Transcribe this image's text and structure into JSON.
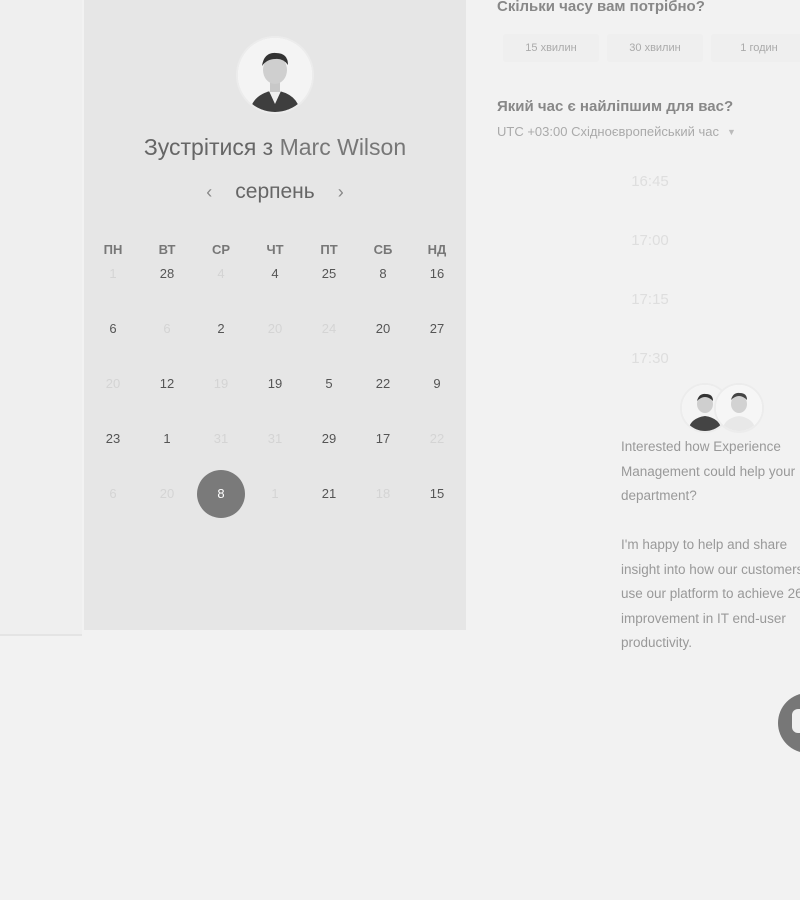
{
  "meeting": {
    "title_prefix": "Зустрітися з",
    "host_name": "Marc Wilson"
  },
  "calendar": {
    "month": "серпень",
    "weekdays": [
      "ПН",
      "ВТ",
      "СР",
      "ЧТ",
      "ПТ",
      "СБ",
      "НД"
    ],
    "weeks": [
      [
        {
          "d": "1",
          "dim": true
        },
        {
          "d": "28"
        },
        {
          "d": "4",
          "dim": true
        },
        {
          "d": "4"
        },
        {
          "d": "25"
        },
        {
          "d": "8"
        },
        {
          "d": "16"
        }
      ],
      [
        {
          "d": "6"
        },
        {
          "d": "6",
          "dim": true
        },
        {
          "d": "2"
        },
        {
          "d": "20",
          "dim": true
        },
        {
          "d": "24",
          "dim": true
        },
        {
          "d": "20"
        },
        {
          "d": "27"
        }
      ],
      [
        {
          "d": "20",
          "dim": true
        },
        {
          "d": "12"
        },
        {
          "d": "19",
          "dim": true
        },
        {
          "d": "19"
        },
        {
          "d": "5"
        },
        {
          "d": "22"
        },
        {
          "d": "9"
        }
      ],
      [
        {
          "d": "23"
        },
        {
          "d": "1"
        },
        {
          "d": "31",
          "dim": true
        },
        {
          "d": "31",
          "dim": true
        },
        {
          "d": "29"
        },
        {
          "d": "17"
        },
        {
          "d": "22",
          "dim": true
        }
      ],
      [
        {
          "d": "6",
          "dim": true
        },
        {
          "d": "20",
          "dim": true
        },
        {
          "d": "8",
          "selected": true
        },
        {
          "d": "1",
          "dim": true
        },
        {
          "d": "21"
        },
        {
          "d": "18",
          "dim": true
        },
        {
          "d": "15"
        }
      ]
    ]
  },
  "duration": {
    "question": "Скільки часу вам потрібно?",
    "options": [
      "15 хвилин",
      "30 хвилин",
      "1 годин"
    ]
  },
  "time": {
    "question": "Який час є найліпшим для вас?",
    "timezone": "UTC +03:00 Східноєвропейський час",
    "slots": [
      "16:45",
      "17:00",
      "17:15",
      "17:30"
    ]
  },
  "message": {
    "paragraph1": [
      "Interested how Experience",
      "Management could help your",
      "department?"
    ],
    "paragraph2": [
      "I'm happy to help and share",
      "insight into how our customers",
      "use our platform to achieve 26",
      "improvement in IT end-user",
      "productivity."
    ]
  },
  "colors": {
    "selected_day": "#7a7a7a",
    "card_bg": "#e6e6e6"
  },
  "icons": {
    "prev": "chevron-left-icon",
    "next": "chevron-right-icon",
    "tz_dropdown": "caret-down-icon",
    "chat": "chat-icon"
  }
}
